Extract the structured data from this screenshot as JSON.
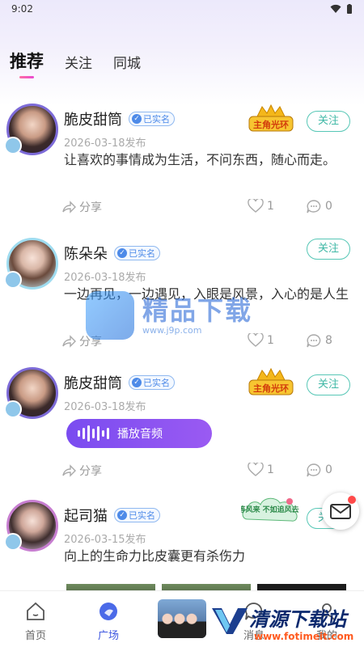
{
  "status": {
    "time": "9:02"
  },
  "tabs": [
    {
      "label": "推荐",
      "active": true
    },
    {
      "label": "关注",
      "active": false
    },
    {
      "label": "同城",
      "active": false
    }
  ],
  "common": {
    "verified_label": "已实名",
    "follow_label": "关注",
    "share_label": "分享"
  },
  "posts": [
    {
      "name": "脆皮甜筒",
      "date": "2026-03-18发布",
      "content": "让喜欢的事情成为生活，不问东西，随心而走。",
      "badge": "主角光环",
      "likes": "1",
      "comments": "0"
    },
    {
      "name": "陈朵朵",
      "date": "2026-03-18发布",
      "content": "一边再见，一边遇见，入眼是风景，入心的是人生",
      "likes": "1",
      "comments": "8"
    },
    {
      "name": "脆皮甜筒",
      "date": "2026-03-18发布",
      "audio_label": "播放音频",
      "badge": "主角光环",
      "likes": "1",
      "comments": "0"
    },
    {
      "name": "起司猫",
      "date": "2026-03-15发布",
      "content": "向上的生命力比皮囊更有杀伤力",
      "badge": "等风来 不如追风去"
    }
  ],
  "watermark": {
    "title": "精品下载",
    "url": "www.j9p.com"
  },
  "watermark2": {
    "title": "清源下载站",
    "url": "www.fotimeit.com"
  },
  "nav": [
    {
      "label": "首页",
      "icon": "home-icon"
    },
    {
      "label": "广场",
      "icon": "plaza-icon",
      "active": true
    },
    {
      "label": "消息",
      "icon": "message-icon"
    },
    {
      "label": "我的",
      "icon": "profile-icon"
    }
  ],
  "colors": {
    "accent": "#3e57e0",
    "follow": "#3fb8a6",
    "audio": "#8a52f1",
    "tab_indicator": "#ff6fa3"
  }
}
